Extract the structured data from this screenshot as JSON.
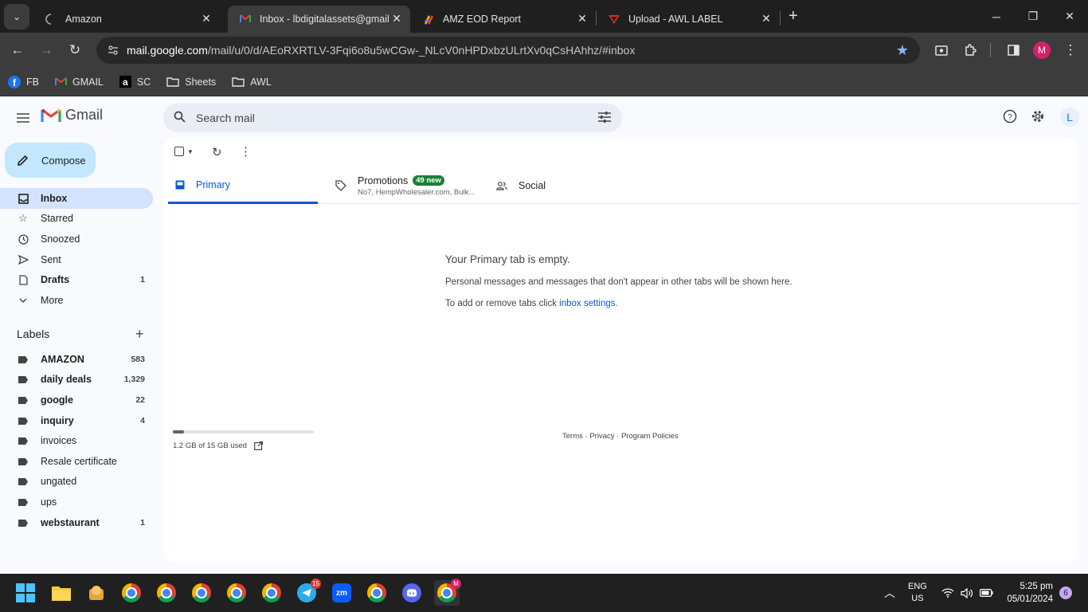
{
  "browser": {
    "tabs": [
      {
        "title": "Amazon",
        "active": false
      },
      {
        "title": "Inbox - lbdigitalassets@gmail.c",
        "active": true
      },
      {
        "title": "AMZ EOD Report",
        "active": false
      },
      {
        "title": "Upload - AWL LABEL",
        "active": false
      }
    ],
    "url_domain": "mail.google.com",
    "url_path": "/mail/u/0/d/AEoRXRTLV-3Fqi6o8u5wCGw-_NLcV0nHPDxbzULrtXv0qCsHAhhz/#inbox",
    "profile_initial": "M",
    "bookmarks": [
      {
        "label": "FB",
        "icon": "facebook-icon"
      },
      {
        "label": "GMAIL",
        "icon": "gmail-icon"
      },
      {
        "label": "SC",
        "icon": "amazon-icon"
      },
      {
        "label": "Sheets",
        "icon": "folder-icon"
      },
      {
        "label": "AWL",
        "icon": "folder-icon"
      }
    ]
  },
  "gmail": {
    "logo_text": "Gmail",
    "compose_label": "Compose",
    "search_placeholder": "Search mail",
    "account_initial": "L",
    "nav": [
      {
        "label": "Inbox",
        "count": "",
        "icon": "inbox-icon"
      },
      {
        "label": "Starred",
        "count": "",
        "icon": "star-icon"
      },
      {
        "label": "Snoozed",
        "count": "",
        "icon": "clock-icon"
      },
      {
        "label": "Sent",
        "count": "",
        "icon": "send-icon"
      },
      {
        "label": "Drafts",
        "count": "1",
        "icon": "draft-icon"
      },
      {
        "label": "More",
        "count": "",
        "icon": "chevron-down-icon"
      }
    ],
    "labels_title": "Labels",
    "labels": [
      {
        "label": "AMAZON",
        "count": "583"
      },
      {
        "label": "daily deals",
        "count": "1,329"
      },
      {
        "label": "google",
        "count": "22"
      },
      {
        "label": "inquiry",
        "count": "4"
      },
      {
        "label": "invoices",
        "count": ""
      },
      {
        "label": "Resale certificate",
        "count": ""
      },
      {
        "label": "ungated",
        "count": ""
      },
      {
        "label": "ups",
        "count": ""
      },
      {
        "label": "webstaurant",
        "count": "1"
      }
    ],
    "tabs": {
      "primary": "Primary",
      "promotions": "Promotions",
      "promotions_badge": "49 new",
      "promotions_snippet": "No7, HempWholesaler.com, Bulk...",
      "social": "Social"
    },
    "empty": {
      "heading": "Your Primary tab is empty.",
      "line1": "Personal messages and messages that don't appear in other tabs will be shown here.",
      "line2_prefix": "To add or remove tabs click ",
      "line2_link": "inbox settings",
      "line2_suffix": "."
    },
    "storage": {
      "text": "1.2 GB of 15 GB used",
      "fraction": 0.08
    },
    "footer": {
      "terms": "Terms",
      "privacy": "Privacy",
      "policies": "Program Policies"
    }
  },
  "taskbar": {
    "telegram_badge": "15",
    "chrome_active_badge": "M",
    "lang_top": "ENG",
    "lang_bottom": "US",
    "time": "5:25 pm",
    "date": "05/01/2024",
    "notif_count": "6"
  }
}
